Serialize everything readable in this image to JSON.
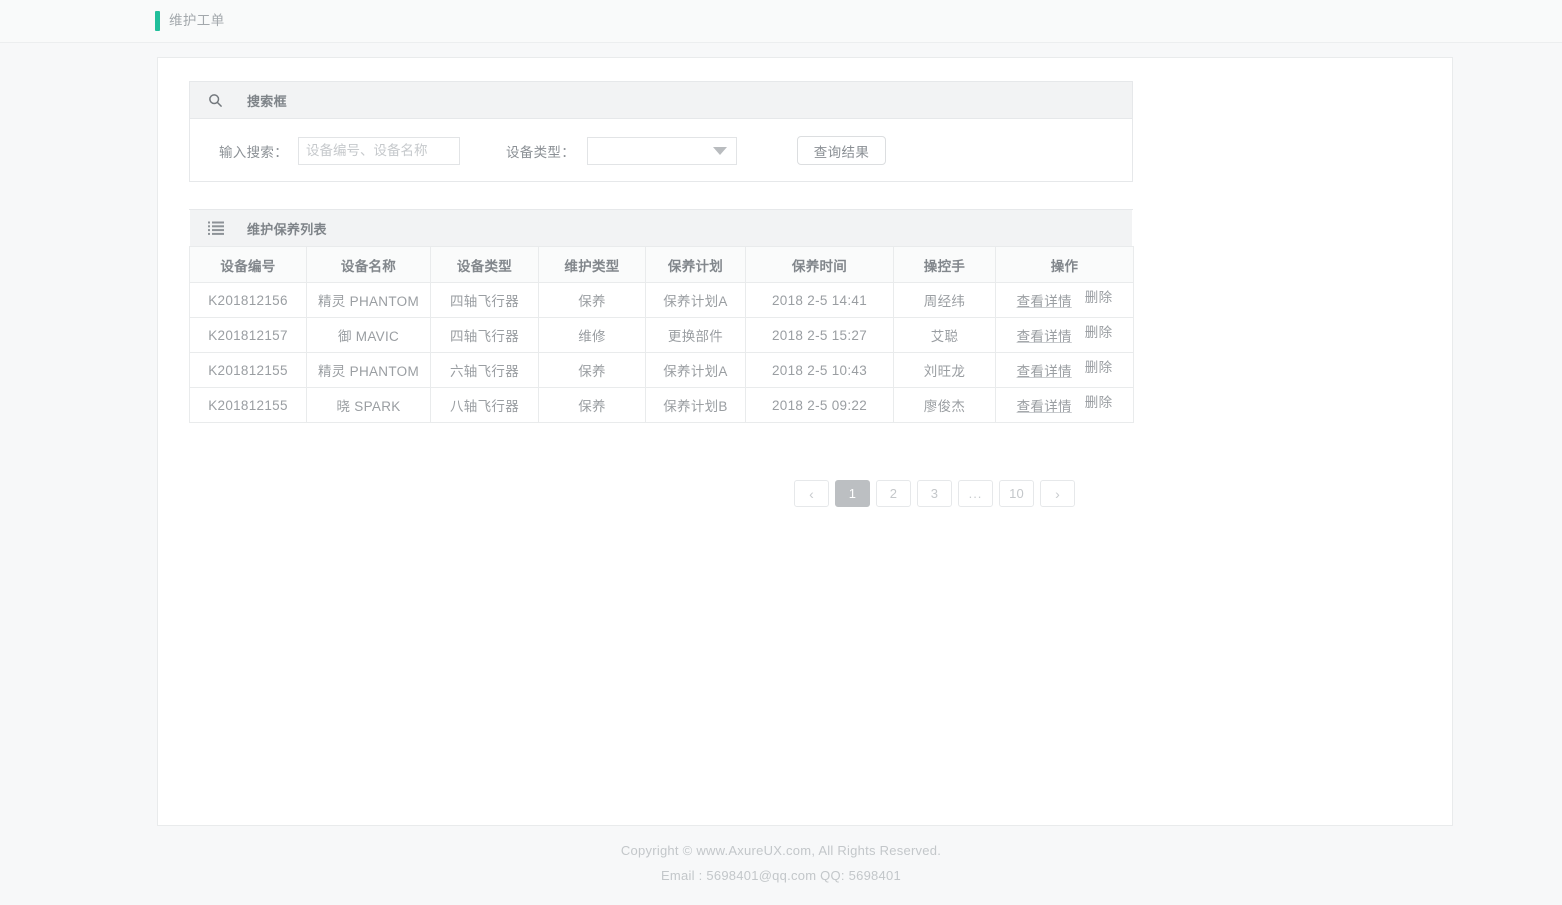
{
  "topbar": {
    "title": "维护工单",
    "accent_color": "#21bf9b"
  },
  "search_panel": {
    "icon": "search-icon",
    "heading": "搜索框",
    "input_label": "输入搜索：",
    "input_value": "",
    "input_placeholder": "设备编号、设备名称",
    "type_label": "设备类型：",
    "type_value": "",
    "query_button": "查询结果"
  },
  "list_panel": {
    "icon": "list-icon",
    "heading": "维护保养列表",
    "columns": [
      "设备编号",
      "设备名称",
      "设备类型",
      "维护类型",
      "保养计划",
      "保养时间",
      "操控手",
      "操作"
    ],
    "rows": [
      {
        "device_id": "K201812156",
        "device_name": "精灵 PHANTOM",
        "device_type": "四轴飞行器",
        "maintain_type": "保养",
        "plan": "保养计划A",
        "time": "2018 2-5 14:41",
        "operator": "周经纬",
        "detail_label": "查看详情",
        "delete_label": "删除"
      },
      {
        "device_id": "K201812157",
        "device_name": "御 MAVIC",
        "device_type": "四轴飞行器",
        "maintain_type": "维修",
        "plan": "更换部件",
        "time": "2018 2-5 15:27",
        "operator": "艾聪",
        "detail_label": "查看详情",
        "delete_label": "删除"
      },
      {
        "device_id": "K201812155",
        "device_name": "精灵 PHANTOM",
        "device_type": "六轴飞行器",
        "maintain_type": "保养",
        "plan": "保养计划A",
        "time": "2018 2-5 10:43",
        "operator": "刘旺龙",
        "detail_label": "查看详情",
        "delete_label": "删除"
      },
      {
        "device_id": "K201812155",
        "device_name": "晓 SPARK",
        "device_type": "八轴飞行器",
        "maintain_type": "保养",
        "plan": "保养计划B",
        "time": "2018 2-5 09:22",
        "operator": "廖俊杰",
        "detail_label": "查看详情",
        "delete_label": "删除"
      }
    ]
  },
  "pagination": {
    "prev": "‹",
    "next": "›",
    "pages": [
      "1",
      "2",
      "3",
      "...",
      "10"
    ],
    "active_page": "1"
  },
  "footer": {
    "line1": "Copyright © www.AxureUX.com, All Rights Reserved.",
    "line2": "Email : 5698401@qq.com  QQ: 5698401"
  }
}
